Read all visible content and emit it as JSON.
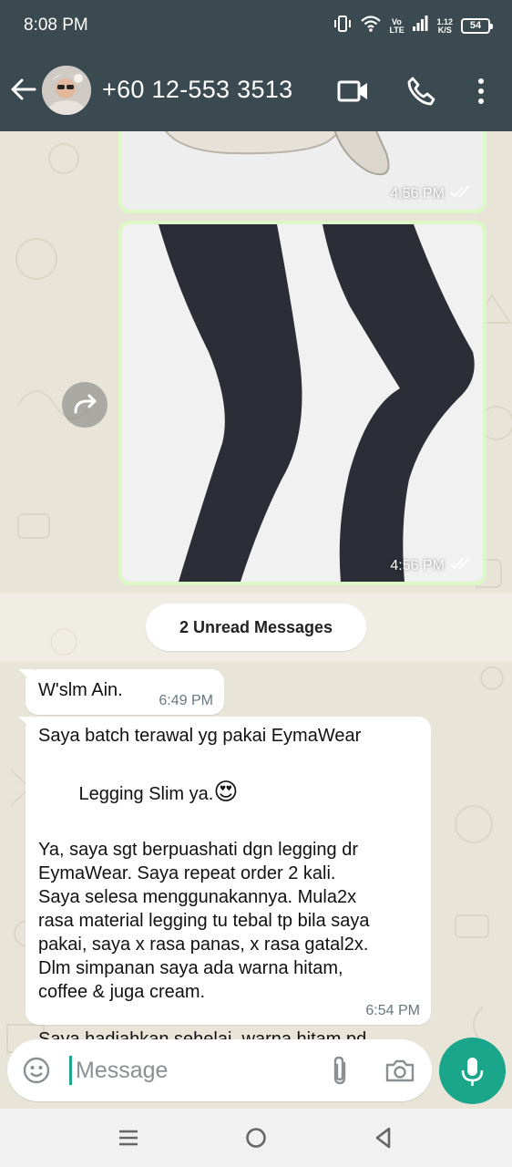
{
  "status_bar": {
    "time": "8:08 PM",
    "network_type": "Vo LTE",
    "speed_value": "1.12",
    "speed_unit": "K/S",
    "battery": "54",
    "icons": [
      "vibrate-icon",
      "wifi-icon",
      "volte-icon",
      "signal-icon",
      "battery-icon"
    ]
  },
  "header": {
    "contact": "+60 12-553 3513",
    "icons": [
      "back-arrow-icon",
      "avatar",
      "video-call-icon",
      "voice-call-icon",
      "more-options-icon"
    ]
  },
  "messages": {
    "image1": {
      "time": "4:56 PM",
      "status": "read"
    },
    "image2": {
      "time": "4:56 PM",
      "status": "read"
    },
    "unread_banner": "2 Unread Messages",
    "msg1": {
      "text": "W'slm Ain.",
      "time": "6:49 PM"
    },
    "msg2": {
      "line1": "Saya batch terawal yg pakai EymaWear",
      "line2": "Legging Slim ya.",
      "emoji": "😍",
      "body": "Ya, saya sgt berpuashati dgn legging dr\nEymaWear. Saya repeat order 2 kali.\nSaya selesa menggunakannya. Mula2x\nrasa material legging tu tebal tp bila saya\npakai, saya x rasa panas, x rasa gatal2x.\nDlm simpanan saya ada warna hitam,\ncoffee & juga cream.\n\nSaya hadiahkan sehelai  warna hitam pd\nkawan baik saya.",
      "time": "6:54 PM"
    }
  },
  "composer": {
    "placeholder": "Message",
    "icons": [
      "emoji-icon",
      "attach-icon",
      "camera-icon",
      "mic-icon"
    ]
  },
  "colors": {
    "header": "#3b4a51",
    "accent": "#1aa68a",
    "outgoing_bubble": "#dcf8c6",
    "incoming_bubble": "#ffffff",
    "chat_bg": "#e9e4d8"
  }
}
